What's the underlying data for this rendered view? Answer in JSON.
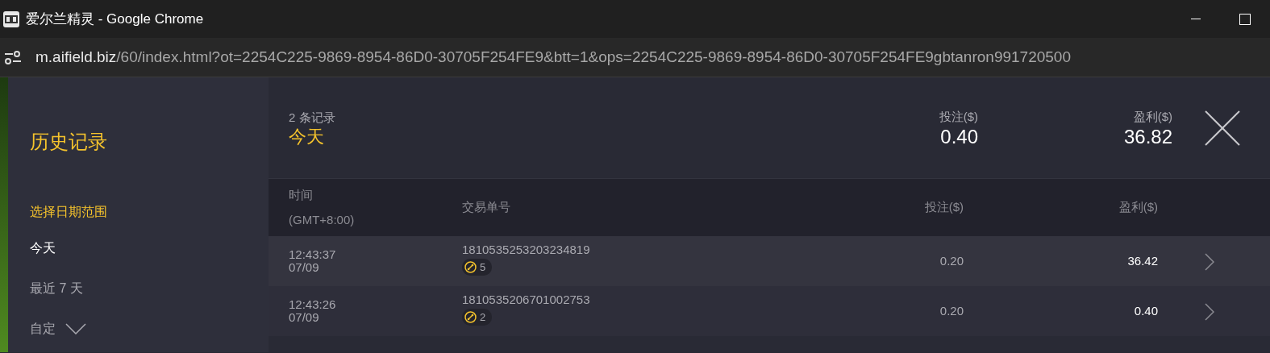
{
  "window": {
    "title": "爱尔兰精灵 - Google Chrome"
  },
  "address_bar": {
    "host": "m.aifield.biz",
    "path": "/60/index.html?ot=2254C225-9869-8954-86D0-30705F254FE9&btt=1&ops=2254C225-9869-8954-86D0-30705F254FE9gbtanron991720500"
  },
  "sidebar": {
    "title": "历史记录",
    "section_label": "选择日期范围",
    "items": [
      {
        "label": "今天",
        "selected": true,
        "kind": "plain"
      },
      {
        "label": "最近 7 天",
        "selected": false,
        "kind": "plain"
      },
      {
        "label": "自定",
        "selected": false,
        "kind": "dropdown"
      }
    ]
  },
  "summary": {
    "count": "2 条记录",
    "period": "今天",
    "bet_label": "投注($)",
    "bet": "0.40",
    "profit_label": "盈利($)",
    "profit": "36.82"
  },
  "table": {
    "columns": [
      {
        "label": "时间",
        "sublabel": "(GMT+8:00)"
      },
      {
        "label": "交易单号"
      },
      {
        "label": "投注($)"
      },
      {
        "label": "盈利($)"
      }
    ],
    "rows": [
      {
        "time": "12:43:37",
        "date": "07/09",
        "id": "1810535253203234819",
        "spins": "5",
        "bet": "0.20",
        "profit": "36.42"
      },
      {
        "time": "12:43:26",
        "date": "07/09",
        "id": "1810535206701002753",
        "spins": "2",
        "bet": "0.20",
        "profit": "0.40"
      }
    ]
  }
}
